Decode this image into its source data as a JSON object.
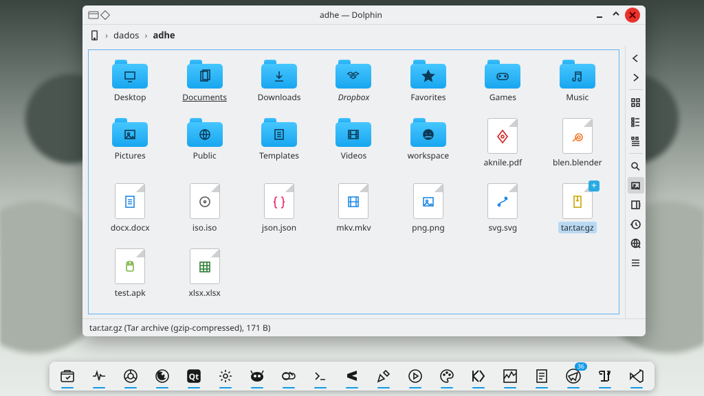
{
  "window": {
    "title": "adhe — Dolphin",
    "breadcrumbs": [
      "dados",
      "adhe"
    ],
    "status": "tar.tar.gz (Tar archive (gzip-compressed), 171 B)",
    "selected": "tar.tar.gz"
  },
  "items": [
    {
      "label": "Desktop",
      "type": "folder",
      "emblem": "desktop"
    },
    {
      "label": "Documents",
      "type": "folder",
      "emblem": "documents",
      "underline": true
    },
    {
      "label": "Downloads",
      "type": "folder",
      "emblem": "downloads"
    },
    {
      "label": "Dropbox",
      "type": "folder",
      "emblem": "dropbox",
      "italic": true
    },
    {
      "label": "Favorites",
      "type": "folder",
      "emblem": "star"
    },
    {
      "label": "Games",
      "type": "folder",
      "emblem": "games"
    },
    {
      "label": "Music",
      "type": "folder",
      "emblem": "music"
    },
    {
      "label": "Pictures",
      "type": "folder",
      "emblem": "pictures"
    },
    {
      "label": "Public",
      "type": "folder",
      "emblem": "public"
    },
    {
      "label": "Templates",
      "type": "folder",
      "emblem": "templates"
    },
    {
      "label": "Videos",
      "type": "folder",
      "emblem": "videos"
    },
    {
      "label": "workspace",
      "type": "folder",
      "emblem": "git"
    },
    {
      "label": "aknile.pdf",
      "type": "file",
      "emblem": "pdf"
    },
    {
      "label": "blen.blender",
      "type": "file",
      "emblem": "blender"
    },
    {
      "label": "docx.docx",
      "type": "file",
      "emblem": "docx"
    },
    {
      "label": "iso.iso",
      "type": "file",
      "emblem": "iso"
    },
    {
      "label": "json.json",
      "type": "file",
      "emblem": "json"
    },
    {
      "label": "mkv.mkv",
      "type": "file",
      "emblem": "mkv"
    },
    {
      "label": "png.png",
      "type": "file",
      "emblem": "png"
    },
    {
      "label": "svg.svg",
      "type": "file",
      "emblem": "svg"
    },
    {
      "label": "tar.tar.gz",
      "type": "file",
      "emblem": "tar",
      "selected": true,
      "plus": true
    },
    {
      "label": "test.apk",
      "type": "file",
      "emblem": "apk"
    },
    {
      "label": "xlsx.xlsx",
      "type": "file",
      "emblem": "xlsx"
    }
  ],
  "sidebar_icons": [
    "back",
    "forward",
    "sep",
    "view-icons",
    "view-compact",
    "view-details",
    "sep",
    "search",
    "preview",
    "panel-right",
    "history",
    "network",
    "menu"
  ],
  "taskbar": [
    {
      "name": "file-manager"
    },
    {
      "name": "monitor"
    },
    {
      "name": "chrome"
    },
    {
      "name": "firefox"
    },
    {
      "name": "qt"
    },
    {
      "name": "settings"
    },
    {
      "name": "gimp"
    },
    {
      "name": "toggle"
    },
    {
      "name": "terminal"
    },
    {
      "name": "sublime"
    },
    {
      "name": "editor"
    },
    {
      "name": "play"
    },
    {
      "name": "palette"
    },
    {
      "name": "kate"
    },
    {
      "name": "activity"
    },
    {
      "name": "notes"
    },
    {
      "name": "telegram",
      "badge": "36"
    },
    {
      "name": "text-tool"
    },
    {
      "name": "vscode"
    }
  ]
}
